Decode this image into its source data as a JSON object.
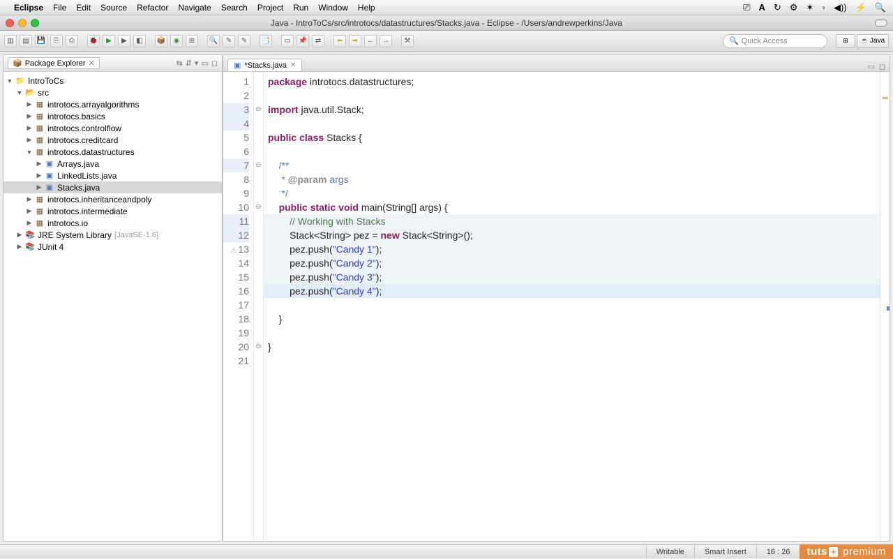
{
  "mac_menu": {
    "app": "Eclipse",
    "items": [
      "File",
      "Edit",
      "Source",
      "Refactor",
      "Navigate",
      "Search",
      "Project",
      "Run",
      "Window",
      "Help"
    ],
    "right_icons": [
      "⎚",
      "A",
      "↻",
      "⚙",
      "✱",
      "⇪",
      "◀))",
      "⚡",
      "🔍"
    ]
  },
  "window": {
    "title": "Java - IntroToCs/src/introtocs/datastructures/Stacks.java - Eclipse - /Users/andrewperkins/Java"
  },
  "toolbar": {
    "quick_access_placeholder": "Quick Access",
    "perspective_label": "Java"
  },
  "package_explorer": {
    "title": "Package Explorer",
    "project": "IntroToCs",
    "src": "src",
    "packages": [
      {
        "name": "introtocs.arrayalgorithms"
      },
      {
        "name": "introtocs.basics"
      },
      {
        "name": "introtocs.controlflow"
      },
      {
        "name": "introtocs.creditcard"
      },
      {
        "name": "introtocs.datastructures",
        "expanded": true,
        "files": [
          "Arrays.java",
          "LinkedLists.java",
          "Stacks.java"
        ]
      },
      {
        "name": "introtocs.inheritanceandpoly"
      },
      {
        "name": "introtocs.intermediate"
      },
      {
        "name": "introtocs.io"
      }
    ],
    "libs": [
      {
        "name": "JRE System Library",
        "suffix": "[JavaSE-1.6]"
      },
      {
        "name": "JUnit 4"
      }
    ],
    "selected_file": "Stacks.java"
  },
  "editor": {
    "tab_label": "*Stacks.java",
    "cursor_line": 16,
    "shaded_lines": [
      3,
      4,
      7,
      11,
      12
    ],
    "lines": [
      {
        "n": 1,
        "tokens": [
          {
            "c": "kw",
            "t": "package"
          },
          {
            "t": " introtocs.datastructures;"
          }
        ]
      },
      {
        "n": 2,
        "tokens": []
      },
      {
        "n": 3,
        "fold": "⊖",
        "tokens": [
          {
            "c": "kw",
            "t": "import"
          },
          {
            "t": " java.util.Stack;"
          }
        ]
      },
      {
        "n": 4,
        "tokens": []
      },
      {
        "n": 5,
        "tokens": [
          {
            "c": "kw",
            "t": "public"
          },
          {
            "t": " "
          },
          {
            "c": "kw",
            "t": "class"
          },
          {
            "t": " Stacks {"
          }
        ]
      },
      {
        "n": 6,
        "tokens": []
      },
      {
        "n": 7,
        "fold": "⊖",
        "tokens": [
          {
            "t": "    "
          },
          {
            "c": "jd",
            "t": "/**"
          }
        ]
      },
      {
        "n": 8,
        "tokens": [
          {
            "t": "     "
          },
          {
            "c": "jd",
            "t": "* "
          },
          {
            "c": "jdt",
            "t": "@param"
          },
          {
            "c": "jd",
            "t": " args"
          }
        ]
      },
      {
        "n": 9,
        "tokens": [
          {
            "t": "     "
          },
          {
            "c": "jd",
            "t": "*/"
          }
        ]
      },
      {
        "n": 10,
        "fold": "⊖",
        "tokens": [
          {
            "t": "    "
          },
          {
            "c": "kw",
            "t": "public"
          },
          {
            "t": " "
          },
          {
            "c": "kw",
            "t": "static"
          },
          {
            "t": " "
          },
          {
            "c": "kw",
            "t": "void"
          },
          {
            "t": " main(String[] args) {"
          }
        ]
      },
      {
        "n": 11,
        "tokens": [
          {
            "t": "        "
          },
          {
            "c": "cm",
            "t": "// Working with Stacks"
          }
        ]
      },
      {
        "n": 12,
        "tokens": [
          {
            "t": "        Stack<String> pez = "
          },
          {
            "c": "kw",
            "t": "new"
          },
          {
            "t": " Stack<String>();"
          }
        ]
      },
      {
        "n": 13,
        "mark": "⚠",
        "tokens": [
          {
            "t": "        pez.push("
          },
          {
            "c": "str",
            "t": "\"Candy 1\""
          },
          {
            "t": ");"
          }
        ]
      },
      {
        "n": 14,
        "tokens": [
          {
            "t": "        pez.push("
          },
          {
            "c": "str",
            "t": "\"Candy 2\""
          },
          {
            "t": ");"
          }
        ]
      },
      {
        "n": 15,
        "tokens": [
          {
            "t": "        pez.push("
          },
          {
            "c": "str",
            "t": "\"Candy 3\""
          },
          {
            "t": ");"
          }
        ]
      },
      {
        "n": 16,
        "tokens": [
          {
            "t": "        pez.push("
          },
          {
            "c": "str",
            "t": "\"Candy 4\""
          },
          {
            "t": ");"
          }
        ]
      },
      {
        "n": 17,
        "tokens": []
      },
      {
        "n": 18,
        "tokens": [
          {
            "t": "    }"
          }
        ]
      },
      {
        "n": 19,
        "tokens": []
      },
      {
        "n": 20,
        "fold": "⊖",
        "tokens": [
          {
            "t": "}"
          }
        ]
      },
      {
        "n": 21,
        "tokens": []
      }
    ]
  },
  "statusbar": {
    "writable": "Writable",
    "insert": "Smart Insert",
    "pos": "16 : 26"
  },
  "watermark": {
    "brand": "tuts",
    "suffix": "premium"
  }
}
